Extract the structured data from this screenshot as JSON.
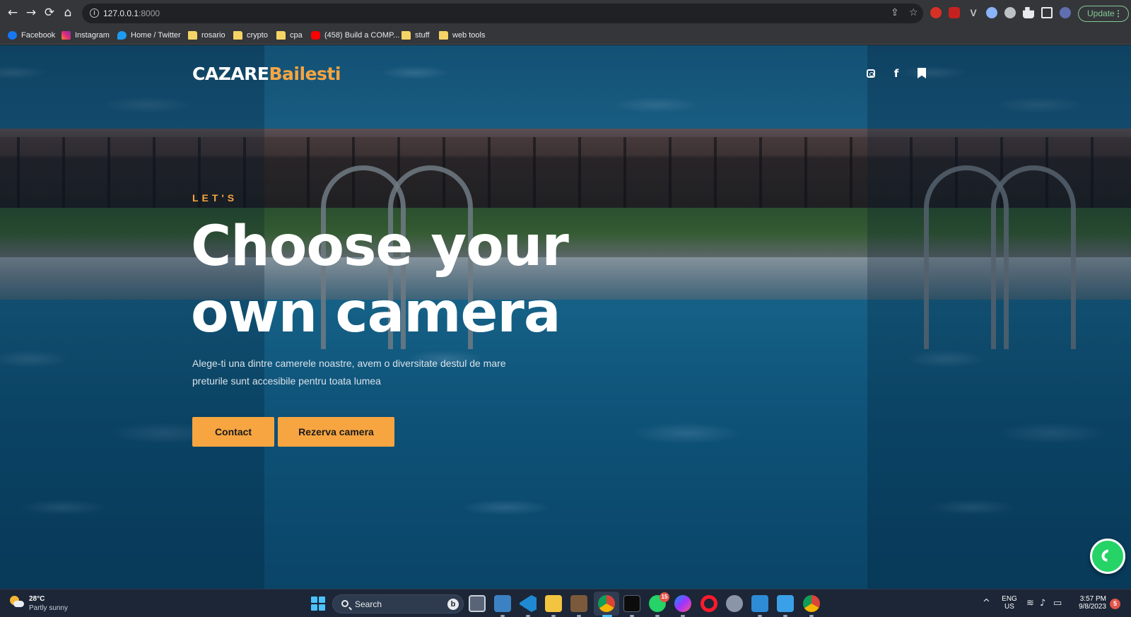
{
  "browser": {
    "nav": {
      "back": "←",
      "forward": "→",
      "reload": "⟳",
      "home": "⌂"
    },
    "address": {
      "host": "127.0.0.1",
      "port": ":8000"
    },
    "update_label": "Update",
    "update_menu": "⋮",
    "share_icon": "⇪",
    "star_icon": "☆",
    "bookmarks": [
      {
        "label": "Facebook",
        "icon": "facebook-icon"
      },
      {
        "label": "Instagram",
        "icon": "instagram-icon"
      },
      {
        "label": "Home / Twitter",
        "icon": "twitter-icon"
      },
      {
        "label": "rosario",
        "icon": "folder-icon"
      },
      {
        "label": "crypto",
        "icon": "folder-icon"
      },
      {
        "label": "cpa",
        "icon": "folder-icon"
      },
      {
        "label": "(458) Build a COMP...",
        "icon": "youtube-icon"
      },
      {
        "label": "stuff",
        "icon": "folder-icon"
      },
      {
        "label": "web tools",
        "icon": "folder-icon"
      }
    ]
  },
  "site": {
    "brand": {
      "primary": "CAZARE",
      "accent": "Bailesti"
    },
    "social_glyphs": {
      "facebook": "f"
    },
    "hero": {
      "eyebrow": "LET'S",
      "headline_line1": "Choose your",
      "headline_line2": "own camera",
      "subtext_line1": "Alege-ti una dintre camerele noastre, avem o diversitate destul de mare",
      "subtext_line2": "preturile sunt accesibile pentru toata lumea",
      "cta_contact": "Contact",
      "cta_reserve": "Rezerva camera"
    },
    "colors": {
      "accent": "#f7a541",
      "whatsapp": "#25d366"
    }
  },
  "taskbar": {
    "weather": {
      "temp": "28°C",
      "desc": "Partly sunny"
    },
    "search_label": "Search",
    "search_bing": "b",
    "whatsapp_badge": "15",
    "lang": {
      "line1": "ENG",
      "line2": "US"
    },
    "clock": {
      "time": "3:57 PM",
      "date": "9/8/2023"
    },
    "notifications": "5",
    "tray_icons": {
      "chevron": "^",
      "wifi": "≋",
      "volume": "♪",
      "battery": "▭"
    }
  }
}
